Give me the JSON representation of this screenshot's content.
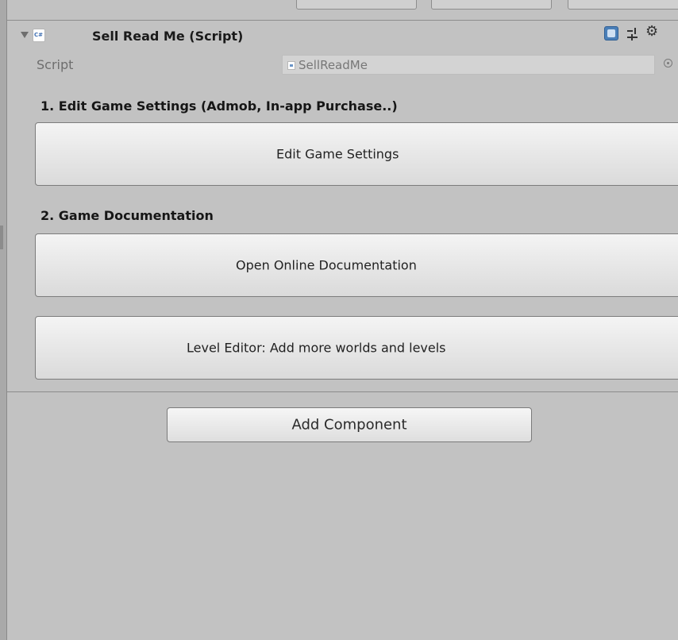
{
  "component": {
    "title": "Sell Read Me (Script)",
    "cs_icon_text": "C#",
    "script_label": "Script",
    "script_value": "SellReadMe"
  },
  "sections": {
    "settings_label": "1. Edit Game Settings (Admob, In-app Purchase..)",
    "docs_label": "2. Game Documentation"
  },
  "buttons": {
    "edit_settings": "Edit Game Settings",
    "open_docs": "Open Online Documentation",
    "level_editor": "Level Editor: Add more worlds and levels",
    "add_component": "Add Component"
  },
  "icons": {
    "fold": "triangle-down-icon",
    "script": "csharp-script-icon",
    "help": "help-book-icon",
    "presets": "preset-sliders-icon",
    "settings": "gear-icon",
    "object_picker": "target-circle-icon"
  }
}
